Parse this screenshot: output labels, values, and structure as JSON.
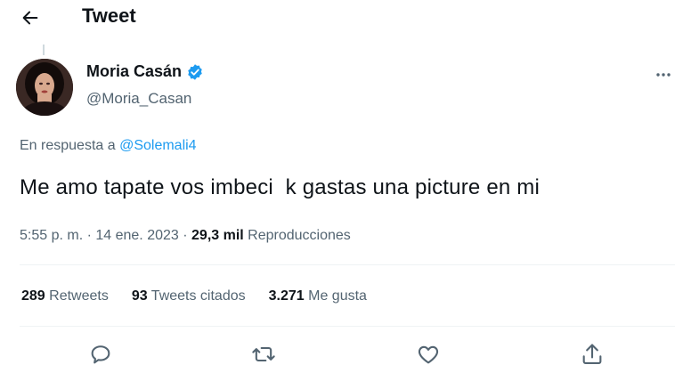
{
  "header": {
    "title": "Tweet",
    "back_icon": "arrow-left-icon"
  },
  "author": {
    "name": "Moria Casán",
    "handle": "@Moria_Casan",
    "verified_icon": "verified-badge-icon",
    "verified_color": "#1d9bf0"
  },
  "more_icon": "more-horizontal-icon",
  "reply": {
    "prefix": "En respuesta a ",
    "mention": "@Solemali4"
  },
  "tweet": {
    "text": "Me amo tapate vos imbeci  k gastas una picture en mi",
    "time": "5:55 p. m. · 14 ene. 2023 · ",
    "views_count": "29,3 mil",
    "views_label": " Reproducciones"
  },
  "stats": {
    "retweets_count": "289",
    "retweets_label": " Retweets",
    "quotes_count": "93",
    "quotes_label": " Tweets citados",
    "likes_count": "3.271",
    "likes_label": " Me gusta"
  },
  "actions": {
    "reply_icon": "reply-icon",
    "retweet_icon": "retweet-icon",
    "like_icon": "heart-icon",
    "share_icon": "share-icon"
  },
  "colors": {
    "accent": "#1d9bf0",
    "text": "#0f1419",
    "secondary": "#536471",
    "divider": "#eff3f4"
  }
}
